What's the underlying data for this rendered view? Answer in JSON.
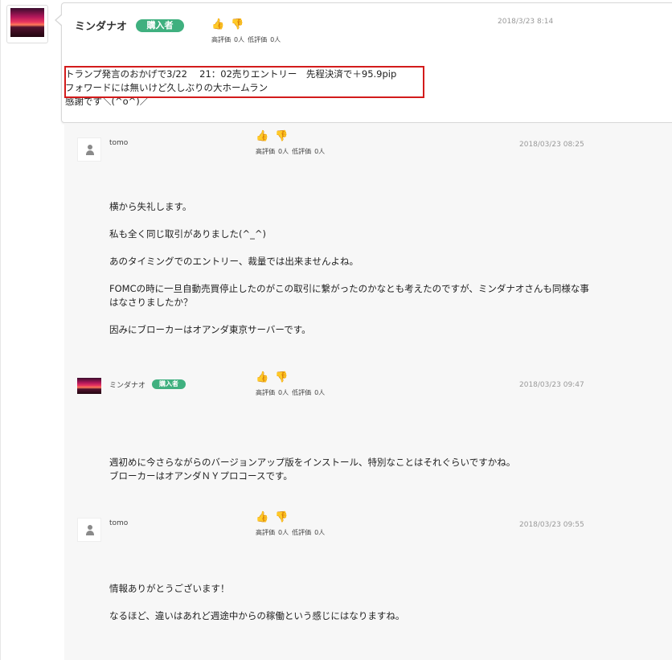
{
  "main_post": {
    "author": "ミンダナオ",
    "badge": "購入者",
    "vote_high_label": "高評価",
    "vote_high_count": "0人",
    "vote_low_label": "低評価",
    "vote_low_count": "0人",
    "date": "2018/3/23 8:14",
    "lines": [
      "トランプ発言のおかげで3/22　 21：02売りエントリー　先程決済で＋95.9pip",
      "フォワードには無いけど久しぶりの大ホームラン",
      "感謝です＼(^o^)／"
    ]
  },
  "replies": [
    {
      "author": "tomo",
      "vote_high_label": "高評価",
      "vote_high_count": "0人",
      "vote_low_label": "低評価",
      "vote_low_count": "0人",
      "date": "2018/03/23 08:25",
      "lines": [
        "横から失礼します。",
        "",
        "私も全く同じ取引がありました(^_^)",
        "",
        "あのタイミングでのエントリー、裁量では出来ませんよね。",
        "",
        "FOMCの時に一旦自動売買停止したのがこの取引に繋がったのかなとも考えたのですが、ミンダナオさんも同様な事",
        "はなさりましたか？",
        "",
        "因みにブローカーはオアンダ東京サーバーです。"
      ]
    },
    {
      "author": "ミンダナオ",
      "badge": "購入者",
      "vote_high_label": "高評価",
      "vote_high_count": "0人",
      "vote_low_label": "低評価",
      "vote_low_count": "0人",
      "date": "2018/03/23 09:47",
      "lines": [
        "週初めに今さらながらのバージョンアップ版をインストール、特別なことはそれぐらいですかね。",
        "ブローカーはオアンダＮＹプロコースです。"
      ]
    },
    {
      "author": "tomo",
      "vote_high_label": "高評価",
      "vote_high_count": "0人",
      "vote_low_label": "低評価",
      "vote_low_count": "0人",
      "date": "2018/03/23 09:55",
      "lines": [
        "情報ありがとうございます！",
        "",
        "なるほど、違いはあれど週途中からの稼働という感じにはなりますね。"
      ]
    }
  ],
  "icons": {
    "thumbs_up": "👍",
    "thumbs_down": "👎"
  },
  "colors": {
    "badge_green": "#3fb07f",
    "highlight_red": "#d31b1b"
  }
}
